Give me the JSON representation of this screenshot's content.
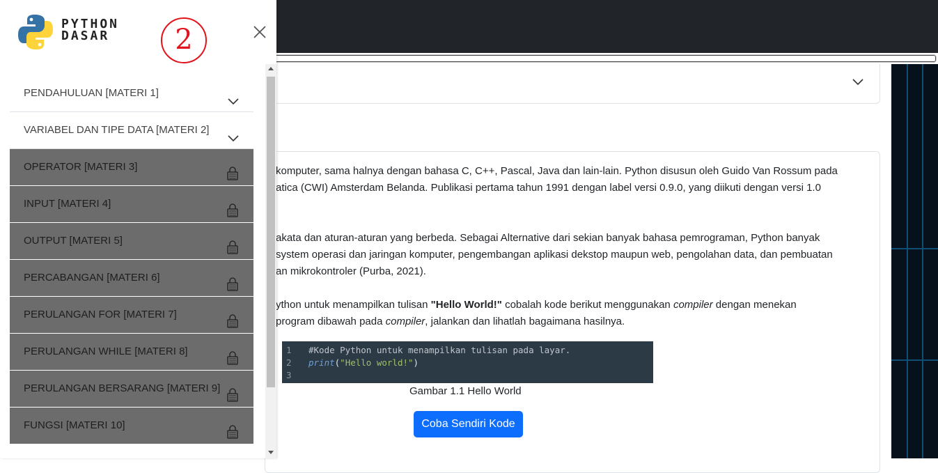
{
  "brand": {
    "line1": "PYTHON",
    "line2": "DASAR"
  },
  "annotation": {
    "label": "2",
    "color": "#e0141c"
  },
  "sidebar": {
    "items": [
      {
        "label": "PENDAHULUAN [MATERI 1]",
        "state": "expandable",
        "icon": "chevron-down-icon"
      },
      {
        "label": "VARIABEL DAN TIPE DATA [MATERI 2]",
        "state": "expandable",
        "icon": "chevron-down-icon"
      },
      {
        "label": "OPERATOR [MATERI 3]",
        "state": "locked",
        "icon": "lock-icon"
      },
      {
        "label": "INPUT [MATERI 4]",
        "state": "locked",
        "icon": "lock-icon"
      },
      {
        "label": "OUTPUT [MATERI 5]",
        "state": "locked",
        "icon": "lock-icon"
      },
      {
        "label": "PERCABANGAN [MATERI 6]",
        "state": "locked",
        "icon": "lock-icon"
      },
      {
        "label": "PERULANGAN FOR [MATERI 7]",
        "state": "locked",
        "icon": "lock-icon"
      },
      {
        "label": "PERULANGAN WHILE [MATERI 8]",
        "state": "locked",
        "icon": "lock-icon"
      },
      {
        "label": "PERULANGAN BERSARANG [MATERI 9]",
        "state": "locked",
        "icon": "lock-icon"
      },
      {
        "label": "FUNGSI [MATERI 10]",
        "state": "locked",
        "icon": "lock-icon"
      }
    ]
  },
  "content": {
    "p1": {
      "l1": "komputer, sama halnya dengan bahasa C, C++, Pascal, Java dan lain-lain. Python disusun oleh Guido Van Rossum pada",
      "l2": "atica (CWI) Amsterdam Belanda. Publikasi pertama tahun 1991 dengan label versi 0.9.0, yang diikuti dengan versi 1.0"
    },
    "p2": {
      "l1": "akata dan aturan-aturan yang berbeda. Sebagai Alternative dari sekian banyak bahasa pemrograman, Python banyak",
      "l2": "system operasi dan jaringan komputer, pengembangan aplikasi dekstop maupun web, pengolahan data, dan pembuatan",
      "l3": "an mikrokontroler (Purba, 2021)."
    },
    "p3": {
      "l1_a": "ython untuk menampilkan tulisan ",
      "l1_b": "\"Hello World!\"",
      "l1_c": " cobalah kode berikut menggunakan ",
      "l1_d": "compiler",
      "l1_e": " dengan menekan",
      "l2_a": "program dibawah pada ",
      "l2_b": "compiler",
      "l2_c": ", jalankan dan lihatlah bagaimana hasilnya."
    },
    "code": {
      "line_numbers": [
        "1",
        "2",
        "3"
      ],
      "line1": "#Kode Python untuk menampilkan tulisan pada layar.",
      "line2_func": "print",
      "line2_open": "(",
      "line2_str": "\"Hello world!\"",
      "line2_close": ")"
    },
    "caption": "Gambar 1.1 Hello World",
    "try_button": "Coba Sendiri Kode"
  }
}
